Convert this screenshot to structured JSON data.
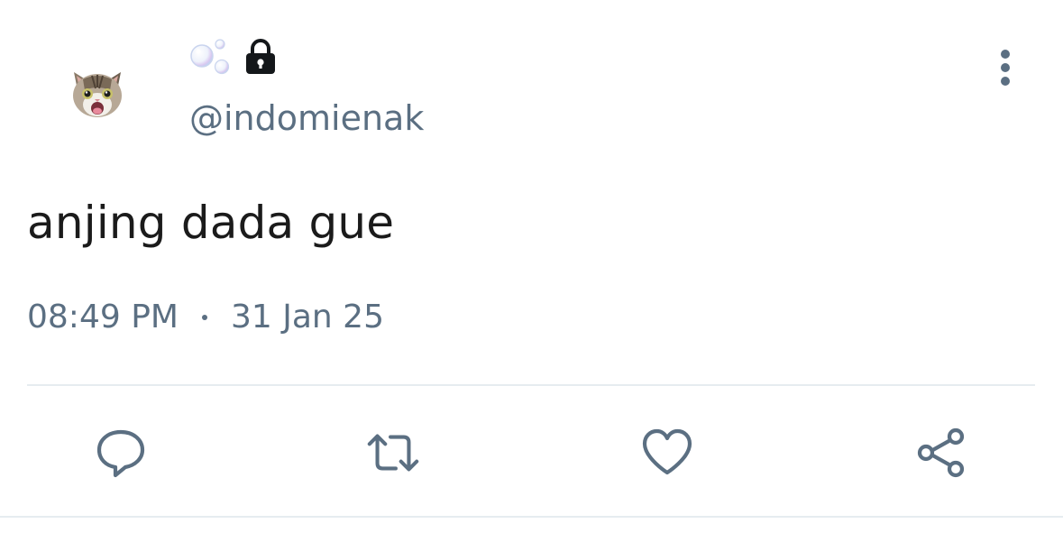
{
  "user": {
    "handle": "@indomienak",
    "display_name_icons": [
      "bubbles-icon",
      "lock-icon"
    ],
    "avatar": "cat-avatar"
  },
  "tweet": {
    "text": "anjing dada gue",
    "time": "08:49 PM",
    "date": "31 Jan 25"
  },
  "actions": [
    "reply-icon",
    "retweet-icon",
    "like-icon",
    "share-icon"
  ],
  "colors": {
    "secondary_text": "#5b6f82",
    "primary_text": "#1b1b1b",
    "divider": "#e6ecf0"
  }
}
